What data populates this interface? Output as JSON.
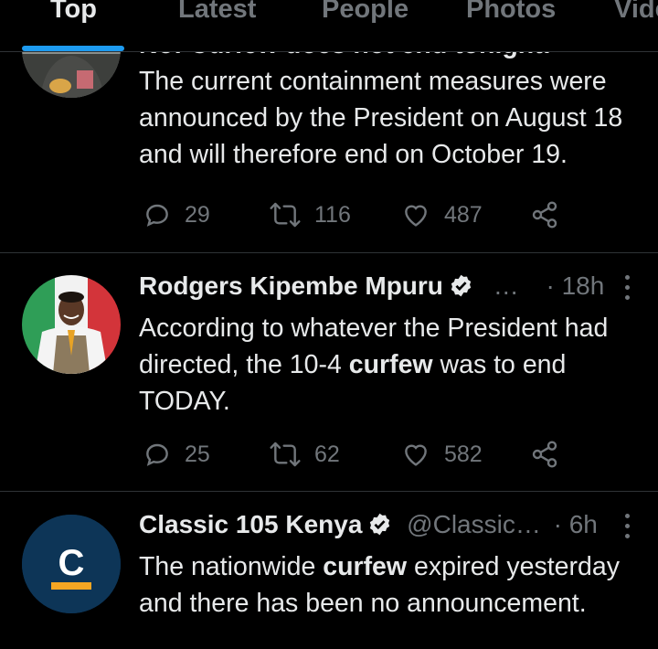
{
  "tabs": [
    {
      "label": "Top",
      "active": true
    },
    {
      "label": "Latest",
      "active": false
    },
    {
      "label": "People",
      "active": false
    },
    {
      "label": "Photos",
      "active": false
    },
    {
      "label": "Videos",
      "active": false
    }
  ],
  "colors": {
    "accent": "#1d9bf0",
    "background": "#000000",
    "muted": "#71767b",
    "text": "#e7e9ea"
  },
  "tweets": [
    {
      "cut_text": "No! Curfew does not end tonight!",
      "text": "The current containment measures were announced by the President on August 18 and will therefore end on October 19.",
      "replies": "29",
      "retweets": "116",
      "likes": "487"
    },
    {
      "name": "Rodgers Kipembe Mpuru",
      "handle": "…",
      "time": "18h",
      "text_a": "According to whatever the President had directed, the 10-4 ",
      "text_bold": "curfew",
      "text_b": " was to end TODAY.",
      "replies": "25",
      "retweets": "62",
      "likes": "582"
    },
    {
      "name": "Classic 105 Kenya",
      "handle": "@Classic…",
      "time": "6h",
      "avatar_letter": "C",
      "text_a": "The nationwide ",
      "text_bold": "curfew",
      "text_b": " expired yesterday and there has been no announcement."
    }
  ]
}
